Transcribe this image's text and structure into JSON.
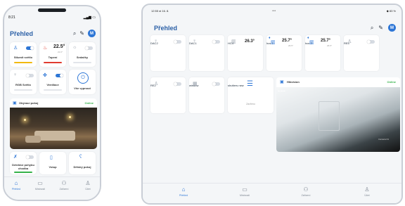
{
  "colors": {
    "accent": "#2d76d6",
    "online": "#35b24a",
    "bar_yellow": "#f2b90f",
    "bar_red": "#e03b2f",
    "bar_green": "#35b24a"
  },
  "phone": {
    "status_time": "8:21",
    "title": "Přehled",
    "avatar_letter": "M",
    "tiles": {
      "t1": {
        "label": "Stlumit světlo"
      },
      "t2": {
        "label": "Topení",
        "temp": "22.5°",
        "sub": "22.0°"
      },
      "t3": {
        "label": "Sedačky"
      },
      "t4": {
        "label": "RGB Světlo"
      },
      "t5": {
        "label": "Ventilace"
      },
      "t6": {
        "label": "Vše vypnout"
      },
      "t7": {
        "label": "Detektor pohybu chodba"
      },
      "t8": {
        "label": "Vstup"
      },
      "t9": {
        "label": "Dětský pokoj"
      }
    },
    "camera": {
      "name": "Obývací pokoj",
      "status": "Online"
    },
    "nav": [
      "Přehled",
      "Místnosti",
      "Zařízení",
      "Účet"
    ]
  },
  "tablet": {
    "status_time": "12:55  st 16. 8.",
    "status_right": "83 %",
    "title": "Přehled",
    "avatar_letter": "M",
    "row1": [
      {
        "label": "DAC2"
      },
      {
        "label": "DAC1"
      },
      {
        "label": "HC4",
        "temp": "26.3°"
      },
      {
        "label": "hcs 1",
        "temp": "25.7°",
        "sub": "26.5°"
      },
      {
        "label": "hcs 2",
        "temp": "25.7°",
        "sub": "26.5°"
      },
      {
        "label": "RE5"
      }
    ],
    "row2": [
      {
        "label": "RE2"
      },
      {
        "label": "window"
      },
      {
        "label": "shutters new",
        "sub": "Zavřeno"
      }
    ],
    "camera": {
      "name": "Hikvision",
      "status": "Online",
      "overlay": "Camera 01"
    },
    "nav": [
      "Přehled",
      "Místnosti",
      "Zařízení",
      "Účet"
    ]
  }
}
